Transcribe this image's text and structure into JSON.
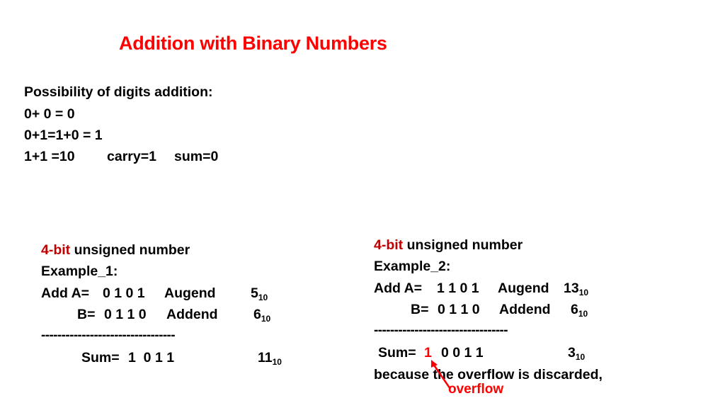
{
  "title": "Addition with Binary Numbers",
  "rules": {
    "heading": "Possibility of digits addition:",
    "lines": [
      "0+ 0 = 0",
      "0+1=1+0 = 1",
      "1+1 =10",
      "carry=1",
      "sum=0"
    ]
  },
  "example1": {
    "bit_label": "4-bit",
    "type_label": " unsigned number",
    "name": "Example_1:",
    "a_prefix": "Add A=",
    "a_bits": "0 1 0 1",
    "a_role": "Augend",
    "a_dec": "5",
    "b_prefix": "B=",
    "b_bits": "0 1 1 0",
    "b_role": "Addend",
    "b_dec": "6",
    "separator": "---------------------------------",
    "sum_prefix": "Sum=",
    "sum_bits": "1  0 1 1",
    "sum_dec": "11",
    "base": "10"
  },
  "example2": {
    "bit_label": "4-bit",
    "type_label": " unsigned number",
    "name": "Example_2:",
    "a_prefix": "Add A=",
    "a_bits": "1 1 0 1",
    "a_role": "Augend",
    "a_dec": "13",
    "b_prefix": "B=",
    "b_bits": "0 1 1 0",
    "b_role": "Addend",
    "b_dec": "6",
    "separator": "---------------------------------",
    "sum_prefix": "Sum=",
    "carry_bit": "1",
    "sum_bits": "0 0 1 1",
    "sum_dec": "3",
    "base": "10",
    "note": "because the overflow is discarded,",
    "overflow_label": "overflow"
  },
  "colors": {
    "title": "#ff0000",
    "bit_label": "#c00000",
    "overflow": "#ff0000"
  }
}
